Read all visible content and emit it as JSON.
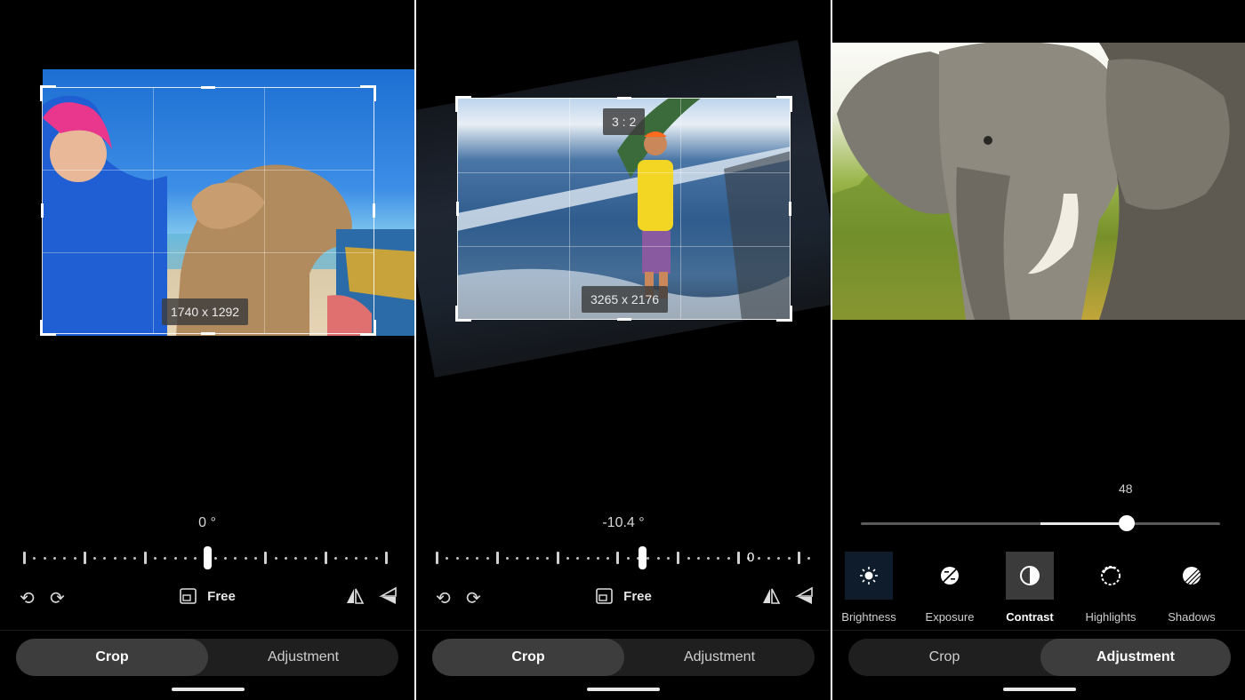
{
  "panels": [
    {
      "crop_dimensions": "1740 x 1292",
      "angle": "0 °",
      "aspect_label": "Free",
      "tabs": [
        "Crop",
        "Adjustment"
      ],
      "active_tab": "Crop"
    },
    {
      "aspect_ratio": "3 : 2",
      "crop_dimensions": "3265 x 2176",
      "angle": "-10.4 °",
      "zero_marker": "0",
      "aspect_label": "Free",
      "tabs": [
        "Crop",
        "Adjustment"
      ],
      "active_tab": "Crop"
    },
    {
      "slider_value": "48",
      "slider_fraction": 0.74,
      "tools": [
        {
          "label": "Brightness",
          "icon": "brightness-icon"
        },
        {
          "label": "Exposure",
          "icon": "exposure-icon"
        },
        {
          "label": "Contrast",
          "icon": "contrast-icon"
        },
        {
          "label": "Highlights",
          "icon": "highlights-icon"
        },
        {
          "label": "Shadows",
          "icon": "shadows-icon"
        }
      ],
      "active_tool": "Contrast",
      "tabs": [
        "Crop",
        "Adjustment"
      ],
      "active_tab": "Adjustment"
    }
  ],
  "colors": {
    "background": "#000000",
    "active_segment": "#3d3d3d",
    "segment_track": "#1f1f1f"
  }
}
